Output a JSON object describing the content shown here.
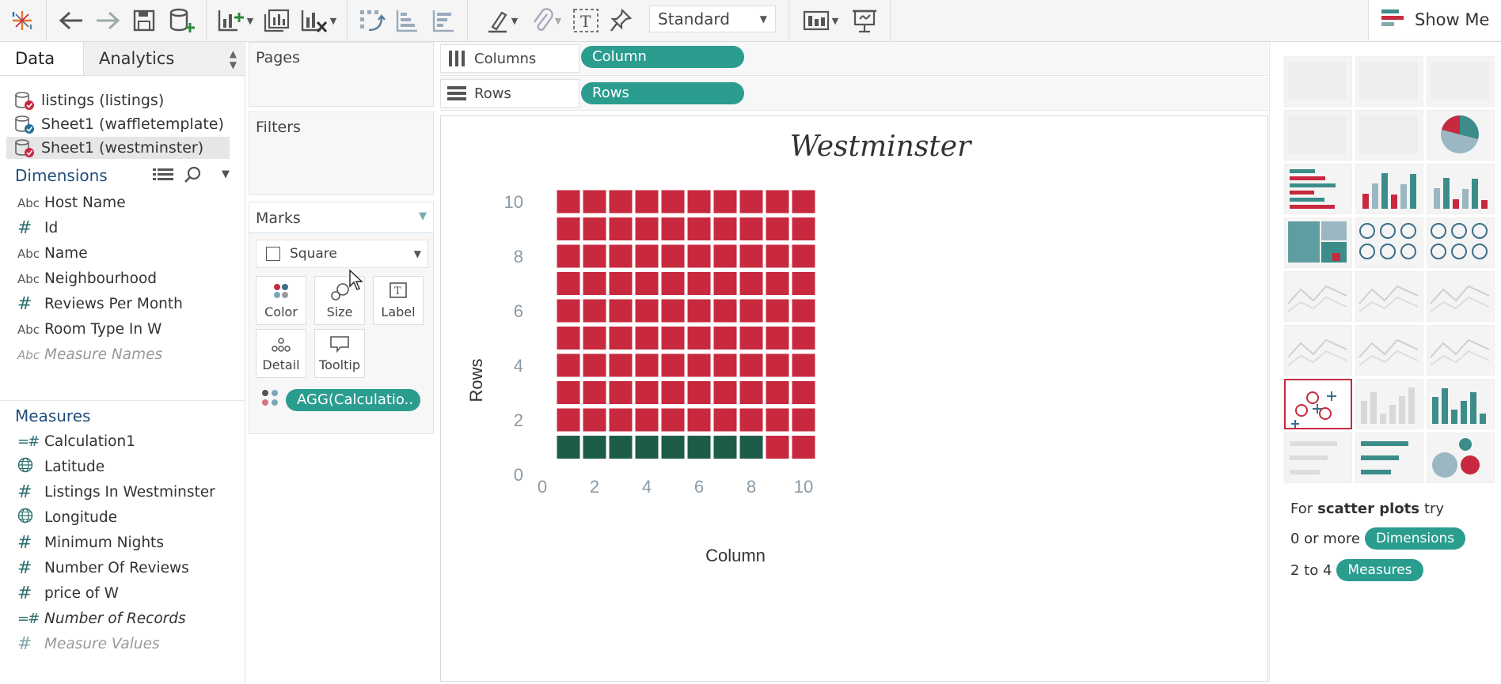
{
  "toolbar": {
    "standard_label": "Standard",
    "show_me_label": "Show Me"
  },
  "data_pane": {
    "tabs": [
      "Data",
      "Analytics"
    ],
    "data_sources": [
      {
        "label": "listings (listings)",
        "selected": false
      },
      {
        "label": "Sheet1 (waffletemplate)",
        "selected": false
      },
      {
        "label": "Sheet1 (westminster)",
        "selected": true
      }
    ],
    "dimensions_title": "Dimensions",
    "dimensions": [
      {
        "type": "Abc",
        "label": "Host Name",
        "style": "normal"
      },
      {
        "type": "#",
        "label": "Id",
        "style": "normal"
      },
      {
        "type": "Abc",
        "label": "Name",
        "style": "normal"
      },
      {
        "type": "Abc",
        "label": "Neighbourhood",
        "style": "normal"
      },
      {
        "type": "#",
        "label": "Reviews Per Month",
        "style": "normal"
      },
      {
        "type": "Abc",
        "label": "Room Type In W",
        "style": "normal"
      },
      {
        "type": "Abc",
        "label": "Measure Names",
        "style": "muted"
      }
    ],
    "measures_title": "Measures",
    "measures": [
      {
        "type": "=#",
        "label": "Calculation1",
        "style": "normal"
      },
      {
        "type": "globe",
        "label": "Latitude",
        "style": "normal"
      },
      {
        "type": "#",
        "label": "Listings In Westminster",
        "style": "normal"
      },
      {
        "type": "globe",
        "label": "Longitude",
        "style": "normal"
      },
      {
        "type": "#",
        "label": "Minimum Nights",
        "style": "normal"
      },
      {
        "type": "#",
        "label": "Number Of Reviews",
        "style": "normal"
      },
      {
        "type": "#",
        "label": "price of W",
        "style": "normal"
      },
      {
        "type": "=#",
        "label": "Number of Records",
        "style": "italic"
      },
      {
        "type": "#",
        "label": "Measure Values",
        "style": "muted"
      }
    ]
  },
  "shelves": {
    "pages_label": "Pages",
    "filters_label": "Filters",
    "marks_label": "Marks",
    "mark_type": "Square",
    "mark_buttons": [
      "Color",
      "Size",
      "Label",
      "Detail",
      "Tooltip"
    ],
    "mark_pill": "AGG(Calculatio..",
    "columns_label": "Columns",
    "columns_pill": "Column",
    "rows_label": "Rows",
    "rows_pill": "Rows"
  },
  "chart_data": {
    "type": "scatter",
    "mark": "square",
    "title": "Westminster",
    "xlabel": "Column",
    "ylabel": "Rows",
    "xlim": [
      0,
      10
    ],
    "ylim": [
      0,
      10
    ],
    "xticks": [
      "0",
      "2",
      "4",
      "6",
      "8",
      "10"
    ],
    "yticks": [
      "0",
      "2",
      "4",
      "6",
      "8",
      "10"
    ],
    "x": [
      1,
      2,
      3,
      4,
      5,
      6,
      7,
      8,
      9,
      10
    ],
    "y": [
      1,
      2,
      3,
      4,
      5,
      6,
      7,
      8,
      9,
      10
    ],
    "highlighted_count": 8,
    "colors": {
      "highlight": "#1e5c4a",
      "other": "#c8293e"
    },
    "grid": false
  },
  "show_me": {
    "hint_prefix": "For",
    "hint_bold": "scatter plots",
    "hint_suffix": "try",
    "req1_prefix": "0 or more",
    "req1_pill": "Dimensions",
    "req2_prefix": "2 to 4",
    "req2_pill": "Measures"
  }
}
